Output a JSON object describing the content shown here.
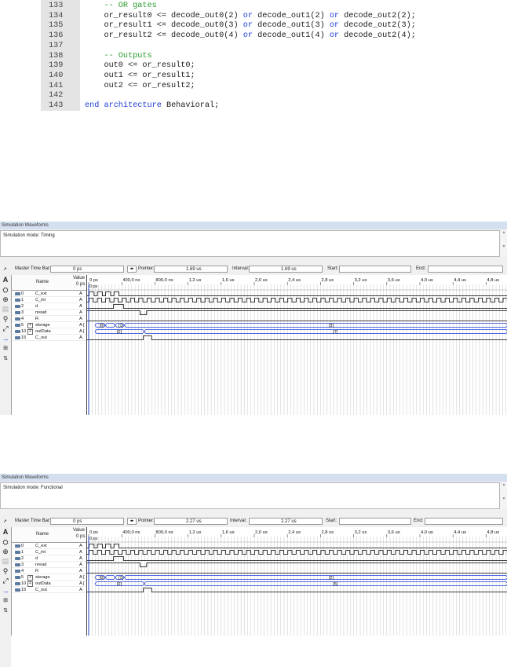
{
  "code": {
    "lines": [
      {
        "n": "133",
        "parts": [
          {
            "t": "    -- OR gates",
            "c": "cm"
          }
        ]
      },
      {
        "n": "134",
        "parts": [
          {
            "t": "    or_result0 <= decode_out0(2) ",
            "c": ""
          },
          {
            "t": "or",
            "c": "kw"
          },
          {
            "t": " decode_out1(2) ",
            "c": ""
          },
          {
            "t": "or",
            "c": "kw"
          },
          {
            "t": " decode_out2(2);",
            "c": ""
          }
        ]
      },
      {
        "n": "135",
        "parts": [
          {
            "t": "    or_result1 <= decode_out0(3) ",
            "c": ""
          },
          {
            "t": "or",
            "c": "kw"
          },
          {
            "t": " decode_out1(3) ",
            "c": ""
          },
          {
            "t": "or",
            "c": "kw"
          },
          {
            "t": " decode_out2(3);",
            "c": ""
          }
        ]
      },
      {
        "n": "136",
        "parts": [
          {
            "t": "    or_result2 <= decode_out0(4) ",
            "c": ""
          },
          {
            "t": "or",
            "c": "kw"
          },
          {
            "t": " decode_out1(4) ",
            "c": ""
          },
          {
            "t": "or",
            "c": "kw"
          },
          {
            "t": " decode_out2(4);",
            "c": ""
          }
        ]
      },
      {
        "n": "137",
        "parts": [
          {
            "t": "",
            "c": ""
          }
        ]
      },
      {
        "n": "138",
        "parts": [
          {
            "t": "    -- Outputs",
            "c": "cm"
          }
        ]
      },
      {
        "n": "139",
        "parts": [
          {
            "t": "    out0 <= or_result0;",
            "c": ""
          }
        ]
      },
      {
        "n": "140",
        "parts": [
          {
            "t": "    out1 <= or_result1;",
            "c": ""
          }
        ]
      },
      {
        "n": "141",
        "parts": [
          {
            "t": "    out2 <= or_result2;",
            "c": ""
          }
        ]
      },
      {
        "n": "142",
        "parts": [
          {
            "t": "",
            "c": ""
          }
        ]
      },
      {
        "n": "143",
        "parts": [
          {
            "t": "end",
            "c": "kw"
          },
          {
            "t": " ",
            "c": ""
          },
          {
            "t": "architecture",
            "c": "kw"
          },
          {
            "t": " Behavioral;",
            "c": ""
          }
        ]
      }
    ]
  },
  "windows": [
    {
      "title": "Simulation Waveforms",
      "mode": "Simulation mode: Timing",
      "master_label": "Master Time Bar:",
      "master_value": "0 ps",
      "pointer_label": "Pointer:",
      "pointer_value": "1.69 us",
      "interval_label": "Interval:",
      "interval_value": "1.69 us",
      "start_label": "Start:",
      "end_label": "End:",
      "col_name": "Name",
      "col_value": "Value",
      "col_value_sub": "0 ps",
      "time_ticks": [
        "0 ps",
        "400,0 ns",
        "800,0 ns",
        "1,2 us",
        "1,6 us",
        "2,0 us",
        "2,4 us",
        "2,8 us",
        "3,2 us",
        "3,6 us",
        "4,0 us",
        "4,4 us",
        "4,8 us"
      ],
      "cursor_label": "0 ps",
      "signals": [
        {
          "id": "0",
          "name": "C_ext",
          "value": "A",
          "kind": "clk_burst"
        },
        {
          "id": "1",
          "name": "C_int",
          "value": "A",
          "kind": "clock"
        },
        {
          "id": "2",
          "name": "d",
          "value": "A",
          "kind": "pulse_d"
        },
        {
          "id": "3",
          "name": "nread",
          "value": "A",
          "kind": "nread"
        },
        {
          "id": "4",
          "name": "R",
          "value": "A",
          "kind": "low"
        },
        {
          "id": "5",
          "name": "storage",
          "value": "A [",
          "kind": "bus_storage",
          "expand": true,
          "labels": [
            "[0]",
            "[1]",
            "[3]"
          ]
        },
        {
          "id": "10",
          "name": "outData",
          "value": "A [",
          "kind": "bus_out",
          "expand": true,
          "labels": [
            "[0]",
            "[7]"
          ]
        },
        {
          "id": "15",
          "name": "C_out",
          "value": "A",
          "kind": "cout"
        }
      ]
    },
    {
      "title": "Simulation Waveforms",
      "mode": "Simulation mode: Functional",
      "master_label": "Master Time Bar:",
      "master_value": "0 ps",
      "pointer_label": "Pointer:",
      "pointer_value": "2.27 us",
      "interval_label": "Interval:",
      "interval_value": "2.27 us",
      "start_label": "Start:",
      "end_label": "End:",
      "col_name": "Name",
      "col_value": "Value",
      "col_value_sub": "0 ps",
      "time_ticks": [
        "0 ps",
        "400,0 ns",
        "800,0 ns",
        "1,2 us",
        "1,6 us",
        "2,0 us",
        "2,4 us",
        "2,8 us",
        "3,2 us",
        "3,6 us",
        "4,0 us",
        "4,4 us",
        "4,8 us"
      ],
      "cursor_label": "0 ps",
      "signals": [
        {
          "id": "0",
          "name": "C_ext",
          "value": "A",
          "kind": "clk_burst"
        },
        {
          "id": "1",
          "name": "C_int",
          "value": "A",
          "kind": "clock"
        },
        {
          "id": "2",
          "name": "d",
          "value": "A",
          "kind": "pulse_d"
        },
        {
          "id": "3",
          "name": "nread",
          "value": "A",
          "kind": "nread"
        },
        {
          "id": "4",
          "name": "R",
          "value": "A",
          "kind": "low"
        },
        {
          "id": "5",
          "name": "storage",
          "value": "A [",
          "kind": "bus_storage",
          "expand": true,
          "labels": [
            "[0]",
            "[1]",
            "[2]"
          ]
        },
        {
          "id": "10",
          "name": "outData",
          "value": "A [",
          "kind": "bus_out",
          "expand": true,
          "labels": [
            "[0]",
            "[5]"
          ]
        },
        {
          "id": "15",
          "name": "C_out",
          "value": "A",
          "kind": "cout"
        }
      ]
    }
  ],
  "colors": {
    "wave": "#000000",
    "bus": "#1e3cd6",
    "cursor": "#2040c0",
    "grid": "#c8c8c8",
    "keyword": "#1e3cd6",
    "comment": "#2a9a2a"
  }
}
